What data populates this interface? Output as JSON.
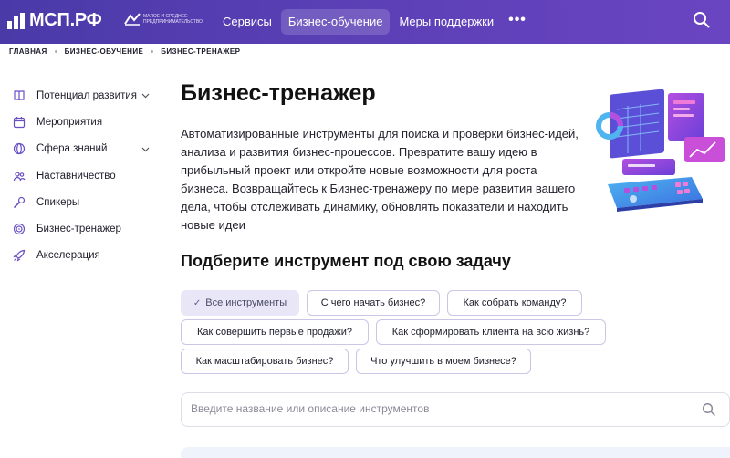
{
  "header": {
    "logo_text": "МСП.РФ",
    "sublogo_text": "МАЛОЕ И СРЕДНЕЕ ПРЕДПРИНИМАТЕЛЬСТВО",
    "nav": [
      {
        "label": "Сервисы",
        "active": false
      },
      {
        "label": "Бизнес-обучение",
        "active": true
      },
      {
        "label": "Меры поддержки",
        "active": false
      }
    ],
    "more_label": "•••",
    "search_icon": "search-icon"
  },
  "breadcrumbs": [
    "ГЛАВНАЯ",
    "БИЗНЕС-ОБУЧЕНИЕ",
    "БИЗНЕС-ТРЕНАЖЕР"
  ],
  "sidebar": {
    "items": [
      {
        "label": "Потенциал развития",
        "icon": "book-icon",
        "expandable": true
      },
      {
        "label": "Мероприятия",
        "icon": "calendar-icon",
        "expandable": false
      },
      {
        "label": "Сфера знаний",
        "icon": "globe-icon",
        "expandable": true
      },
      {
        "label": "Наставничество",
        "icon": "people-icon",
        "expandable": false
      },
      {
        "label": "Спикеры",
        "icon": "microphone-icon",
        "expandable": false
      },
      {
        "label": "Бизнес-тренажер",
        "icon": "target-icon",
        "expandable": false
      },
      {
        "label": "Акселерация",
        "icon": "rocket-icon",
        "expandable": false
      }
    ]
  },
  "main": {
    "title": "Бизнес-тренажер",
    "description": "Автоматизированные инструменты для поиска и проверки бизнес-идей, анализа и развития бизнес-процессов. Превратите вашу идею в прибыльный проект или откройте новые возможности для роста бизнеса. Возвращайтесь к Бизнес-тренажеру по мере развития вашего дела, чтобы отслеживать динамику, обновлять показатели и находить новые идеи",
    "subtitle": "Подберите инструмент под свою задачу",
    "chips": [
      {
        "label": "Все инструменты",
        "selected": true
      },
      {
        "label": "С чего начать бизнес?",
        "selected": false
      },
      {
        "label": "Как собрать команду?",
        "selected": false
      },
      {
        "label": "Как совершить первые продажи?",
        "selected": false
      },
      {
        "label": "Как сформировать клиента на всю жизнь?",
        "selected": false
      },
      {
        "label": "Как масштабировать бизнес?",
        "selected": false
      },
      {
        "label": "Что улучшить в моем бизнесе?",
        "selected": false
      }
    ],
    "search": {
      "placeholder": "Введите название или описание инструментов",
      "value": ""
    }
  },
  "colors": {
    "header_start": "#4a3aa8",
    "header_end": "#6a45c2",
    "accent": "#5a3fb5",
    "chip_border": "#c9c6e6",
    "chip_selected_bg": "#e9e7f7"
  }
}
